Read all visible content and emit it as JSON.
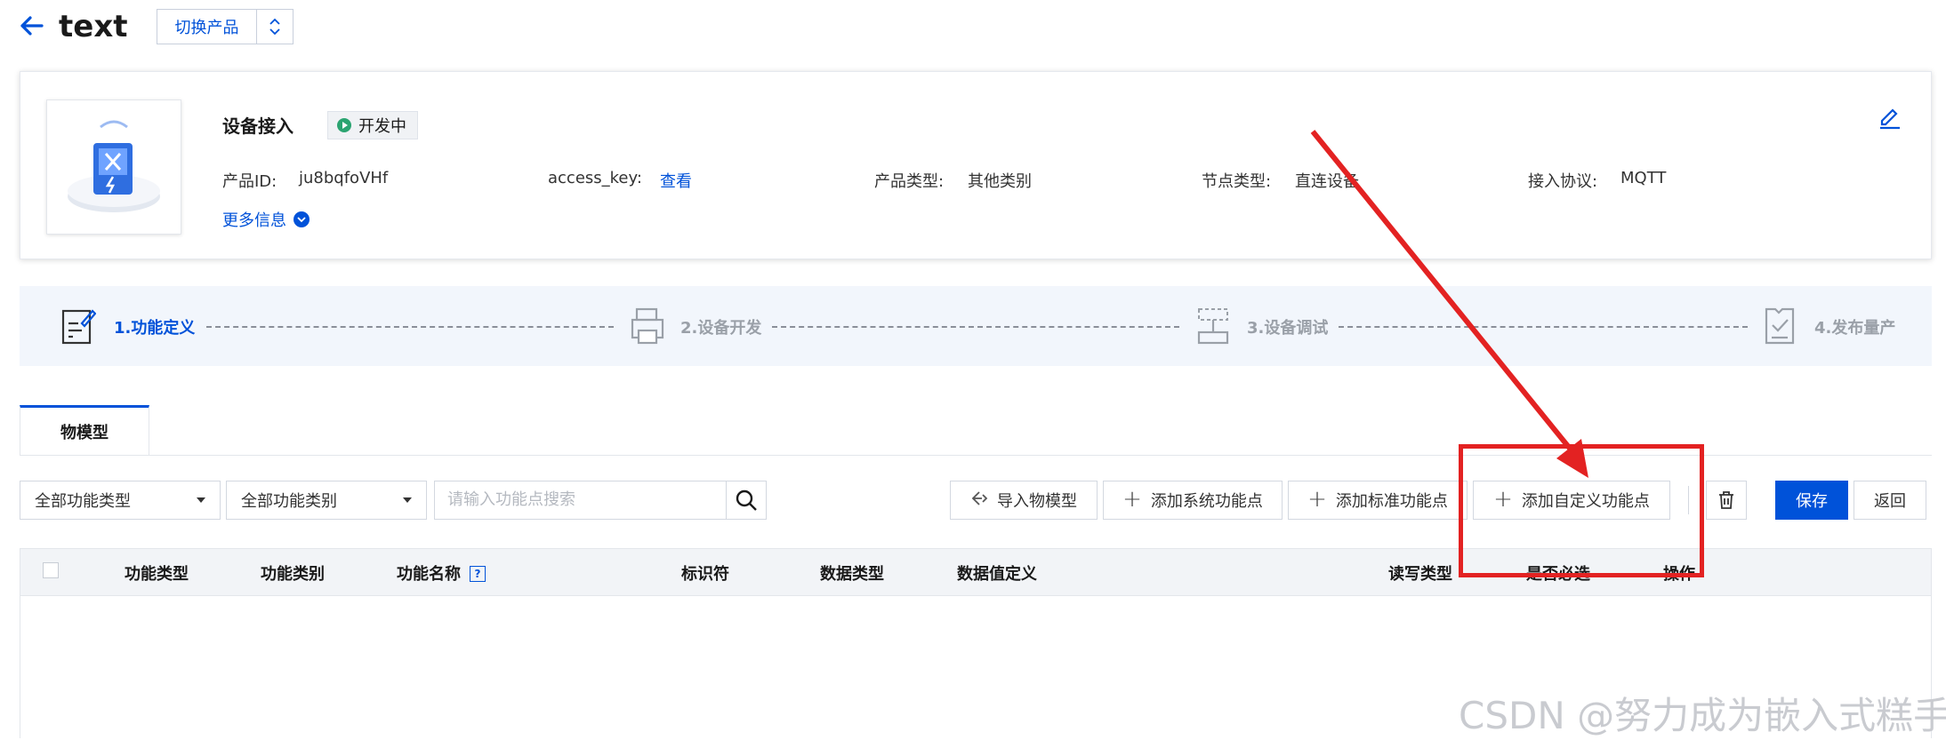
{
  "header": {
    "back_icon": "arrow-left-icon",
    "title": "text",
    "switch_label": "切换产品"
  },
  "product": {
    "name": "设备接入",
    "status": "开发中",
    "status_color": "#2ba471",
    "fields": [
      {
        "label": "产品ID:",
        "value": "ju8bqfoVHf"
      },
      {
        "label": "access_key:",
        "value": "查看"
      },
      {
        "label": "产品类型:",
        "value": "其他类别"
      },
      {
        "label": "节点类型:",
        "value": "直连设备"
      },
      {
        "label": "接入协议:",
        "value": "MQTT"
      }
    ],
    "more_label": "更多信息"
  },
  "steps": [
    {
      "label": "1.功能定义",
      "active": true
    },
    {
      "label": "2.设备开发",
      "active": false
    },
    {
      "label": "3.设备调试",
      "active": false
    },
    {
      "label": "4.发布量产",
      "active": false
    }
  ],
  "tabs": [
    {
      "label": "物模型",
      "active": true
    }
  ],
  "toolbar": {
    "filter_type": "全部功能类型",
    "filter_category": "全部功能类别",
    "search_placeholder": "请输入功能点搜索",
    "import_label": "导入物模型",
    "add_system_label": "添加系统功能点",
    "add_standard_label": "添加标准功能点",
    "add_custom_label": "添加自定义功能点",
    "save_label": "保存",
    "back_label": "返回"
  },
  "table": {
    "columns": [
      "功能类型",
      "功能类别",
      "功能名称",
      "标识符",
      "数据类型",
      "数据值定义",
      "读写类型",
      "是否必选",
      "操作"
    ]
  },
  "watermark": "CSDN @努力成为嵌入式糕手",
  "colors": {
    "accent": "#0052d9",
    "annotation": "#e32222",
    "step_bg": "#f2f6fc"
  }
}
